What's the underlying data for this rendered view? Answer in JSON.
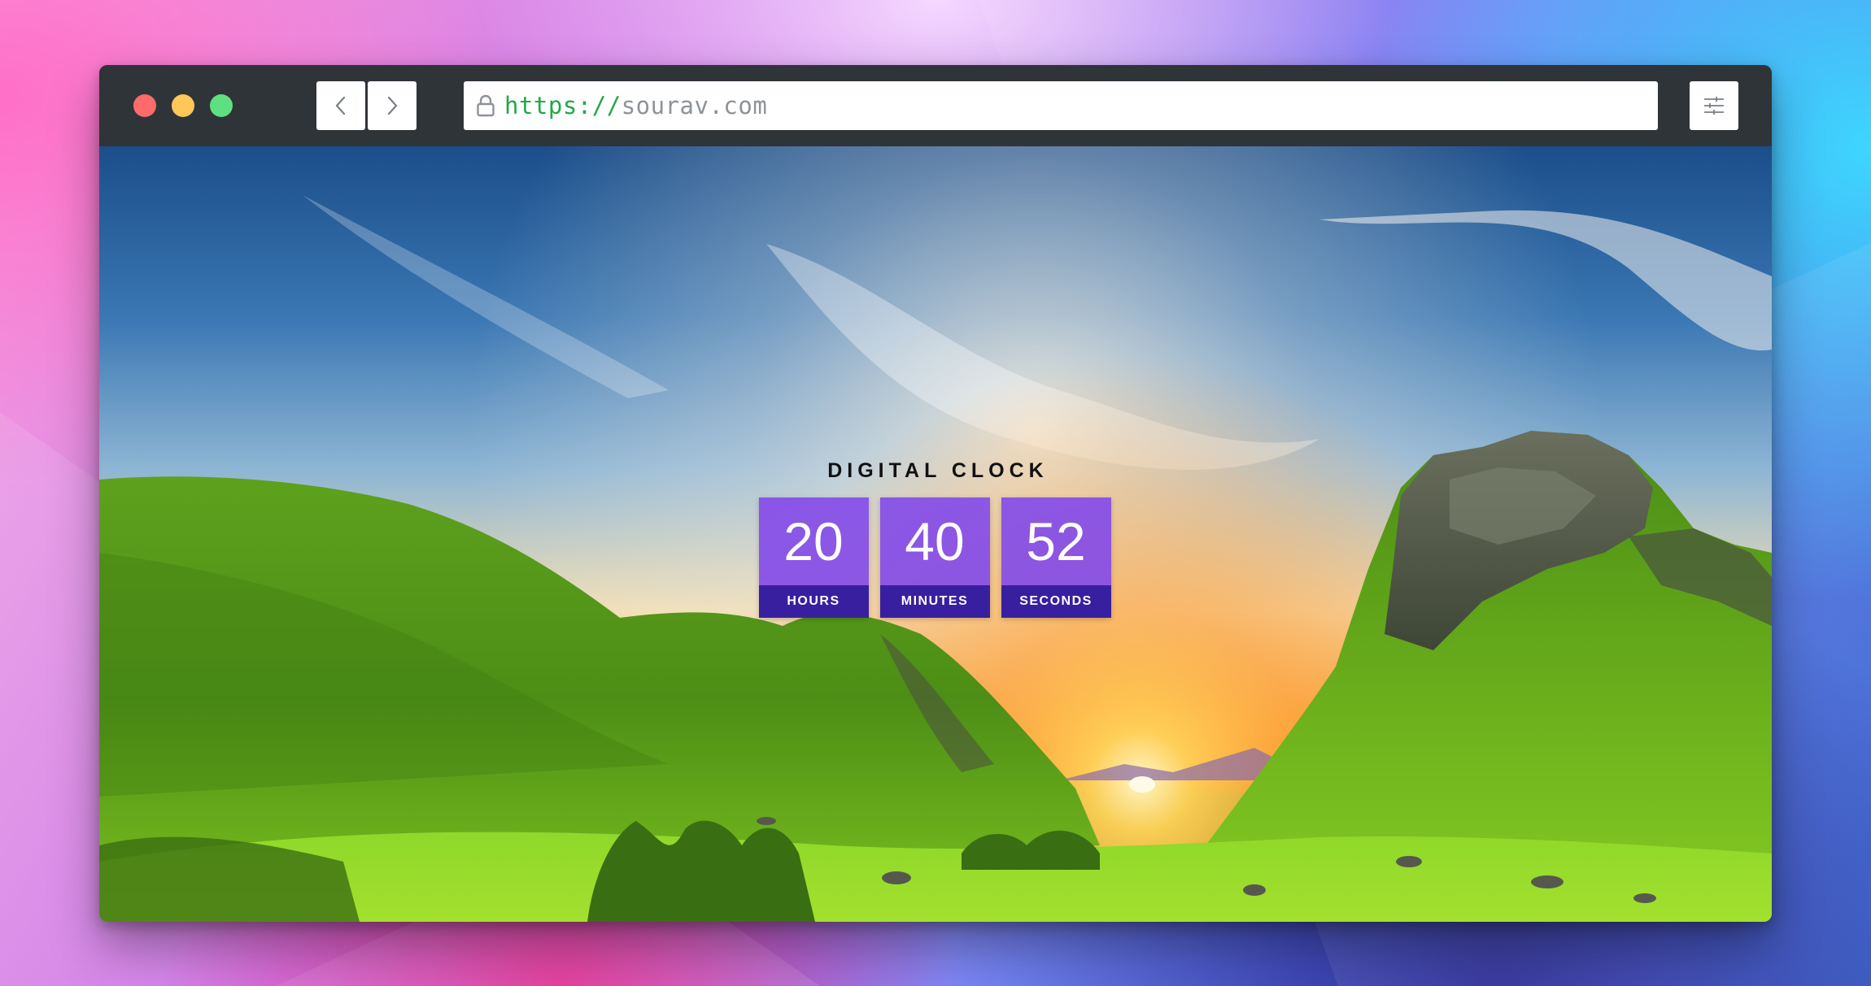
{
  "browser": {
    "url_scheme": "https://",
    "url_host": "sourav.com"
  },
  "clock": {
    "title": "DIGITAL CLOCK",
    "hours": {
      "value": "20",
      "label": "HOURS"
    },
    "minutes": {
      "value": "40",
      "label": "MINUTES"
    },
    "seconds": {
      "value": "52",
      "label": "SECONDS"
    }
  },
  "colors": {
    "close": "#ff6b6b",
    "minimize": "#ffc75a",
    "maximize": "#5fe080",
    "url_scheme": "#22a849",
    "clock_box": "#844ce8",
    "clock_label_bar": "#341c9c"
  },
  "icons": [
    "lock-icon",
    "chevron-left-icon",
    "chevron-right-icon",
    "sliders-icon"
  ]
}
